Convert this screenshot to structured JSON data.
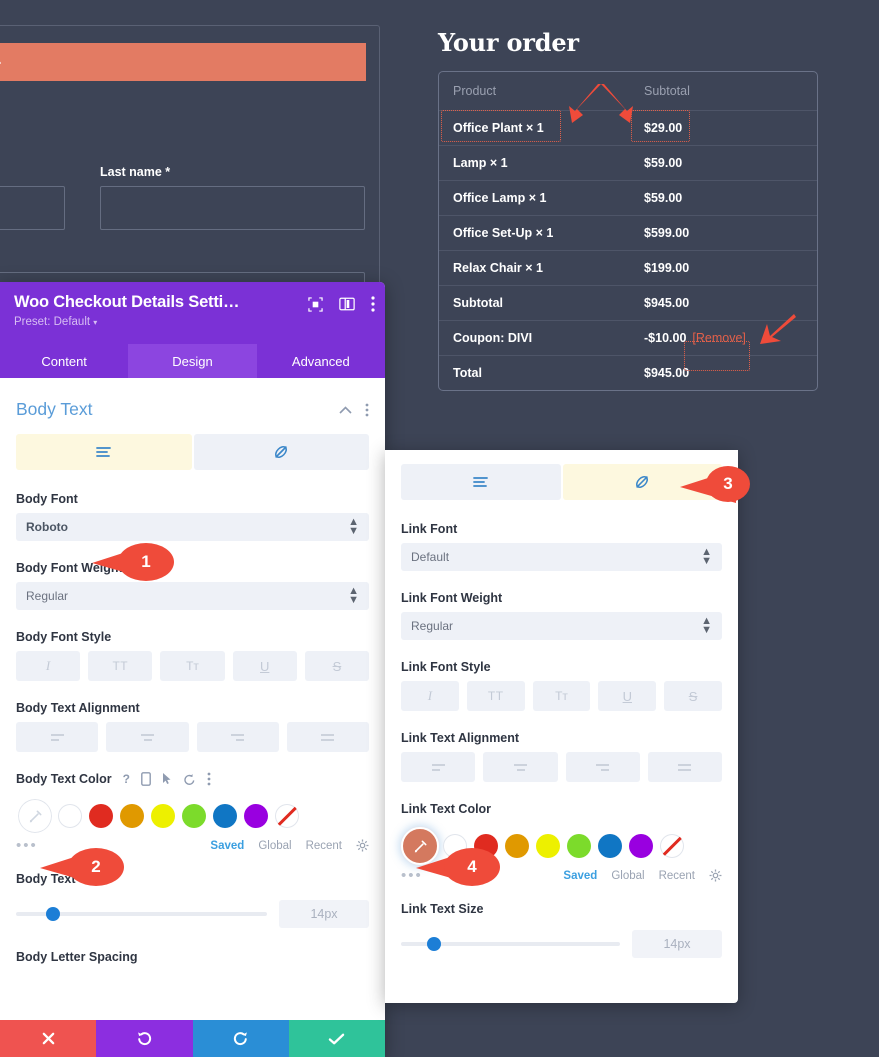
{
  "checkout": {
    "notice_text": "field.",
    "last_name_label": "Last name *",
    "order_title": "Your order",
    "table": {
      "headers": [
        "Product",
        "Subtotal"
      ],
      "rows": [
        {
          "product": "Office Plant",
          "qty": "× 1",
          "subtotal": "$29.00",
          "highlight": true
        },
        {
          "product": "Lamp",
          "qty": "× 1",
          "subtotal": "$59.00",
          "highlight": false
        },
        {
          "product": "Office Lamp",
          "qty": "× 1",
          "subtotal": "$59.00",
          "highlight": false
        },
        {
          "product": "Office Set-Up",
          "qty": "× 1",
          "subtotal": "$599.00",
          "highlight": false
        },
        {
          "product": "Relax Chair",
          "qty": "× 1",
          "subtotal": "$199.00",
          "highlight": false
        },
        {
          "product": "Subtotal",
          "qty": "",
          "subtotal": "$945.00",
          "highlight": false
        },
        {
          "product": "Coupon: DIVI",
          "qty": "",
          "subtotal": "-$10.00",
          "remove": "[Remove]",
          "highlight": false
        },
        {
          "product": "Total",
          "qty": "",
          "subtotal": "$945.00",
          "highlight": false
        }
      ]
    }
  },
  "divi": {
    "title": "Woo Checkout Details Setti…",
    "preset": "Preset: Default",
    "preset_caret": "▾",
    "tabs": [
      {
        "label": "Content",
        "active": false
      },
      {
        "label": "Design",
        "active": true
      },
      {
        "label": "Advanced",
        "active": false
      }
    ],
    "footer": [
      {
        "name": "discard",
        "icon": "✕",
        "color": "#ef5350"
      },
      {
        "name": "undo",
        "icon": "↺",
        "color": "#8c2ee0"
      },
      {
        "name": "redo",
        "icon": "↻",
        "color": "#2a8ed6"
      },
      {
        "name": "save",
        "icon": "✓",
        "color": "#2fc39a"
      }
    ]
  },
  "body_panel": {
    "section_title": "Body Text",
    "tab_text_icon": "text-lines-icon",
    "tab_link_icon": "link-icon",
    "font_label": "Body Font",
    "font_value": "Roboto",
    "weight_label": "Body Font Weight",
    "weight_value": "Regular",
    "style_label": "Body Font Style",
    "style_buttons": [
      "I",
      "TT",
      "Tᴛ",
      "U",
      "S"
    ],
    "align_label": "Body Text Alignment",
    "color_label": "Body Text Color",
    "color_help": "?",
    "saved_label": "Saved",
    "global_label": "Global",
    "recent_label": "Recent",
    "dots": "•••",
    "size_label": "Body Text Size",
    "size_value": "14px",
    "next_label": "Body Letter Spacing",
    "swatches": [
      "#ffffff",
      "#e02b20",
      "#e09900",
      "#edf000",
      "#7cdb2b",
      "#1076c4",
      "#9900e0",
      "transparent"
    ],
    "selected_swatch": "#ffffff"
  },
  "link_panel": {
    "tab_text_icon": "text-lines-icon",
    "tab_link_icon": "link-icon",
    "font_label": "Link Font",
    "font_value": "Default",
    "weight_label": "Link Font Weight",
    "weight_value": "Regular",
    "style_label": "Link Font Style",
    "style_buttons": [
      "I",
      "TT",
      "Tᴛ",
      "U",
      "S"
    ],
    "align_label": "Link Text Alignment",
    "color_label": "Link Text Color",
    "saved_label": "Saved",
    "global_label": "Global",
    "recent_label": "Recent",
    "dots": "•••",
    "size_label": "Link Text Size",
    "size_value": "14px",
    "swatches": [
      "#ffffff",
      "#e02b20",
      "#e09900",
      "#edf000",
      "#7cdb2b",
      "#1076c4",
      "#9900e0",
      "transparent"
    ],
    "selected_swatch": "#d4795f"
  },
  "annotations": {
    "badges": [
      {
        "label": "1"
      },
      {
        "label": "2"
      },
      {
        "label": "3"
      },
      {
        "label": "4"
      }
    ],
    "accent_color": "#ef4b3a"
  }
}
